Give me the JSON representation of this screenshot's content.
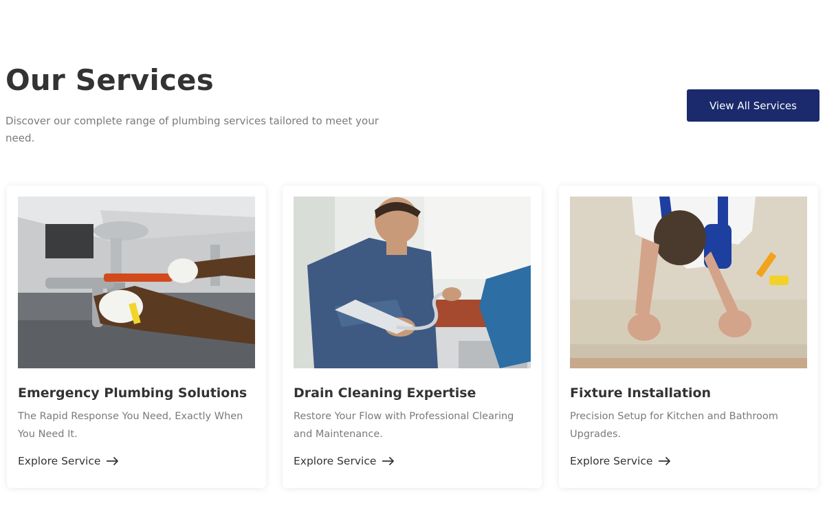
{
  "header": {
    "title": "Our Services",
    "subtitle": "Discover our complete range of plumbing services tailored to meet your need.",
    "cta_label": "View All Services",
    "cta_color": "#1a2a6c"
  },
  "services": [
    {
      "title": "Emergency Plumbing Solutions",
      "description": "The Rapid Response You Need, Exactly When You Need It.",
      "link_label": "Explore Service",
      "image": "plumber-fixing-sink-pipe-photo"
    },
    {
      "title": "Drain Cleaning Expertise",
      "description": "Restore Your Flow with Professional Clearing and Maintenance.",
      "link_label": "Explore Service",
      "image": "plumber-holding-faucet-photo"
    },
    {
      "title": "Fixture Installation",
      "description": "Precision Setup for Kitchen and Bathroom Upgrades.",
      "link_label": "Explore Service",
      "image": "worker-installing-carpet-photo"
    }
  ],
  "icons": {
    "link_arrow": "arrow-right-icon"
  }
}
